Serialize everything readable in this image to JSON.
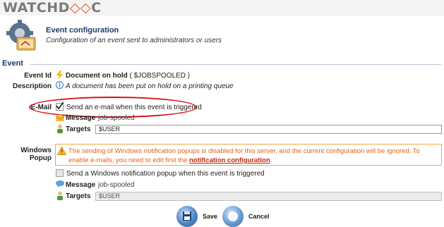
{
  "brand": {
    "logo_left": "WATCHD",
    "logo_mark": "◇◇",
    "logo_right": "C"
  },
  "header": {
    "title": "Event configuration",
    "subtitle": "Configuration of an event sent to administrators or users"
  },
  "section": {
    "title": "Event"
  },
  "event": {
    "id_label": "Event Id",
    "id_name": "Document on hold",
    "id_code": " ( $JOBSPOOLED )",
    "description_label": "Description",
    "description_value": "A document has been put on hold on a printing queue"
  },
  "email": {
    "label": "E-Mail",
    "checkbox_label": "Send an e-mail when this event is triggered",
    "checked": true,
    "message_label": "Message",
    "message_value": "job-spooled",
    "targets_label": "Targets",
    "targets_value": "$USER"
  },
  "popup": {
    "label": "Windows Popup",
    "warning_text": "The sending of Windows notification popups is disabled for this server, and the current configuration will be ignored. To enable e-mails, you need to edit first the ",
    "warning_link": "notification configuration",
    "warning_end": ".",
    "checkbox_label": "Send a Windows notification popup when this event is triggered",
    "checked": false,
    "message_label": "Message",
    "message_value": "job-spooled",
    "targets_label": "Targets",
    "targets_value": "$USER"
  },
  "actions": {
    "save_label": "Save",
    "cancel_label": "Cancel"
  },
  "colors": {
    "accent": "#1e3c6b",
    "warning": "#e4621a",
    "highlight": "#d7141b"
  }
}
